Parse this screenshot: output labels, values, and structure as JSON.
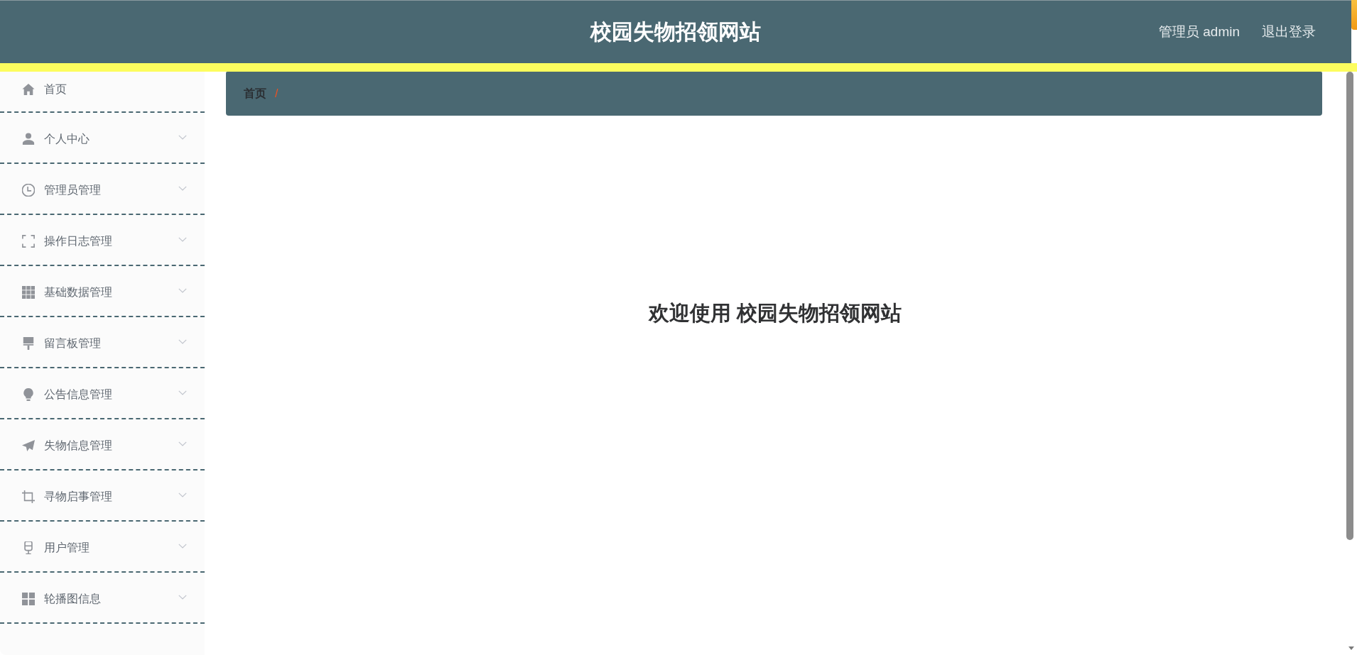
{
  "header": {
    "title": "校园失物招领网站",
    "user": "管理员 admin",
    "logout": "退出登录"
  },
  "sidebar": {
    "items": [
      {
        "label": "首页",
        "kind": "link"
      },
      {
        "label": "个人中心",
        "kind": "submenu",
        "expanded": false
      },
      {
        "label": "管理员管理",
        "kind": "submenu",
        "expanded": false
      },
      {
        "label": "操作日志管理",
        "kind": "submenu",
        "expanded": false
      },
      {
        "label": "基础数据管理",
        "kind": "submenu",
        "expanded": false
      },
      {
        "label": "留言板管理",
        "kind": "submenu",
        "expanded": false
      },
      {
        "label": "公告信息管理",
        "kind": "submenu",
        "expanded": false
      },
      {
        "label": "失物信息管理",
        "kind": "submenu",
        "expanded": false
      },
      {
        "label": "寻物启事管理",
        "kind": "submenu",
        "expanded": false
      },
      {
        "label": "用户管理",
        "kind": "submenu",
        "expanded": false
      },
      {
        "label": "轮播图信息",
        "kind": "submenu",
        "expanded": false
      }
    ]
  },
  "breadcrumb": [
    {
      "label": "首页",
      "separator": "/"
    }
  ],
  "main": {
    "welcome": "欢迎使用 校园失物招领网站"
  }
}
